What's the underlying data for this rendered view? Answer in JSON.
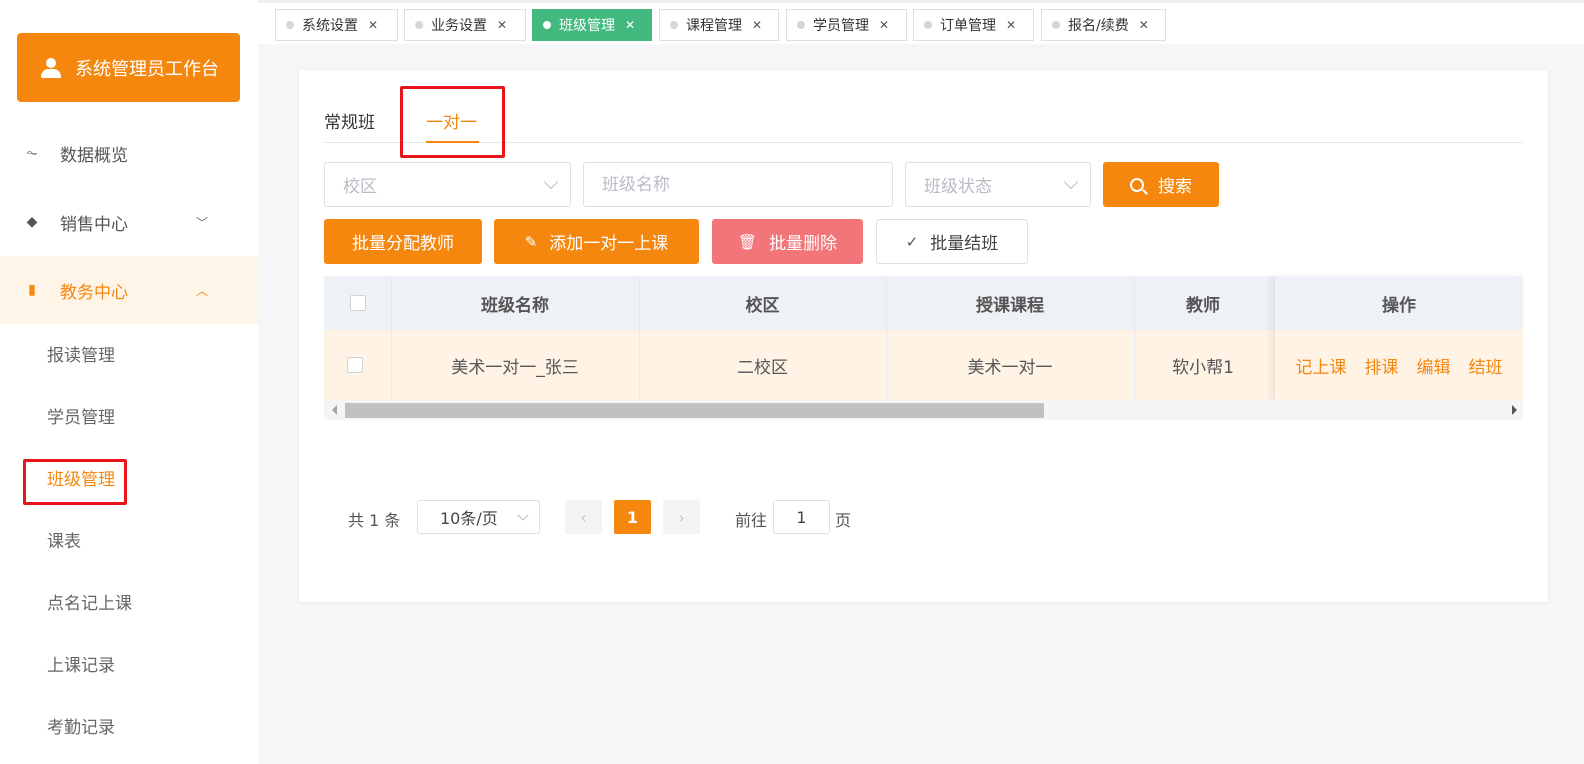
{
  "sidebar": {
    "workbench_label": "系统管理员工作台",
    "menu": [
      {
        "label": "数据概览"
      },
      {
        "label": "销售中心"
      },
      {
        "label": "教务中心"
      }
    ],
    "sub_items": [
      "报读管理",
      "学员管理",
      "班级管理",
      "课表",
      "点名记上课",
      "上课记录",
      "考勤记录"
    ]
  },
  "tabs": [
    "系统设置",
    "业务设置",
    "班级管理",
    "课程管理",
    "学员管理",
    "订单管理",
    "报名/续费"
  ],
  "active_tab": "班级管理",
  "subtabs": [
    "常规班",
    "一对一"
  ],
  "active_subtab": "一对一",
  "filters": {
    "campus_placeholder": "校区",
    "class_name_placeholder": "班级名称",
    "status_placeholder": "班级状态",
    "search_label": "搜索"
  },
  "actions": {
    "assign_teacher": "批量分配教师",
    "add_one_on_one": "添加一对一上课",
    "batch_delete": "批量删除",
    "batch_close": "批量结班"
  },
  "table": {
    "headers": {
      "class_name": "班级名称",
      "campus": "校区",
      "course": "授课课程",
      "teacher": "教师",
      "ops": "操作"
    },
    "rows": [
      {
        "class_name": "美术一对一_张三",
        "campus": "二校区",
        "course": "美术一对一",
        "teacher": "软小帮1",
        "ops": [
          "记上课",
          "排课",
          "编辑",
          "结班"
        ]
      }
    ]
  },
  "pagination": {
    "total": "共 1 条",
    "page_size": "10条/页",
    "current_page": "1",
    "goto_label": "前往",
    "goto_value": "1",
    "unit": "页"
  },
  "colors": {
    "accent": "#f5870f",
    "tab_active": "#43b97f",
    "danger": "#f27679",
    "highlight": "#e8141b"
  }
}
